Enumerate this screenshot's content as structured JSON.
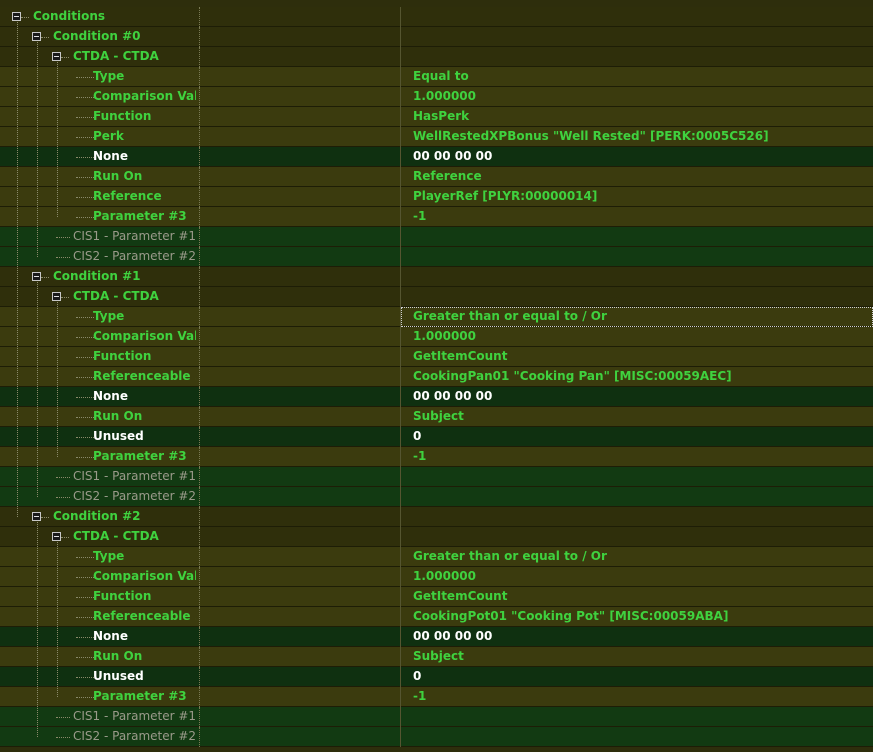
{
  "root": {
    "label": "Conditions"
  },
  "conditions": [
    {
      "label": "Condition #0",
      "ctda_label": "CTDA - CTDA",
      "fields": [
        {
          "name": "Type",
          "value": "Equal to",
          "style": "olive"
        },
        {
          "name": "Comparison Valu...",
          "value": "1.000000",
          "style": "olive"
        },
        {
          "name": "Function",
          "value": "HasPerk",
          "style": "olive"
        },
        {
          "name": "Perk",
          "value": "WellRestedXPBonus \"Well Rested\" [PERK:0005C526]",
          "style": "olive"
        },
        {
          "name": "None",
          "value": "00 00 00 00",
          "style": "none"
        },
        {
          "name": "Run On",
          "value": "Reference",
          "style": "olive"
        },
        {
          "name": "Reference",
          "value": "PlayerRef [PLYR:00000014]",
          "style": "olive"
        },
        {
          "name": "Parameter #3",
          "value": "-1",
          "style": "olive"
        }
      ],
      "extras": [
        "CIS1 - Parameter #1",
        "CIS2 - Parameter #2"
      ]
    },
    {
      "label": "Condition #1",
      "ctda_label": "CTDA - CTDA",
      "fields": [
        {
          "name": "Type",
          "value": "Greater than or equal to / Or",
          "style": "olive"
        },
        {
          "name": "Comparison Valu...",
          "value": "1.000000",
          "style": "olive"
        },
        {
          "name": "Function",
          "value": "GetItemCount",
          "style": "olive"
        },
        {
          "name": "Referenceable ...",
          "value": "CookingPan01 \"Cooking Pan\" [MISC:00059AEC]",
          "style": "olive"
        },
        {
          "name": "None",
          "value": "00 00 00 00",
          "style": "none"
        },
        {
          "name": "Run On",
          "value": "Subject",
          "style": "olive"
        },
        {
          "name": "Unused",
          "value": "0",
          "style": "none"
        },
        {
          "name": "Parameter #3",
          "value": "-1",
          "style": "olive"
        }
      ],
      "extras": [
        "CIS1 - Parameter #1",
        "CIS2 - Parameter #2"
      ]
    },
    {
      "label": "Condition #2",
      "ctda_label": "CTDA - CTDA",
      "fields": [
        {
          "name": "Type",
          "value": "Greater than or equal to / Or",
          "style": "olive"
        },
        {
          "name": "Comparison Valu...",
          "value": "1.000000",
          "style": "olive"
        },
        {
          "name": "Function",
          "value": "GetItemCount",
          "style": "olive"
        },
        {
          "name": "Referenceable ...",
          "value": "CookingPot01 \"Cooking Pot\" [MISC:00059ABA]",
          "style": "olive"
        },
        {
          "name": "None",
          "value": "00 00 00 00",
          "style": "none"
        },
        {
          "name": "Run On",
          "value": "Subject",
          "style": "olive"
        },
        {
          "name": "Unused",
          "value": "0",
          "style": "none"
        },
        {
          "name": "Parameter #3",
          "value": "-1",
          "style": "olive"
        }
      ],
      "extras": [
        "CIS1 - Parameter #1",
        "CIS2 - Parameter #2"
      ]
    }
  ],
  "colors": {
    "text_green": "#3fd23f",
    "row_olive": "#3b3b0e",
    "row_green": "#123a12",
    "background": "#2e2e0c"
  }
}
